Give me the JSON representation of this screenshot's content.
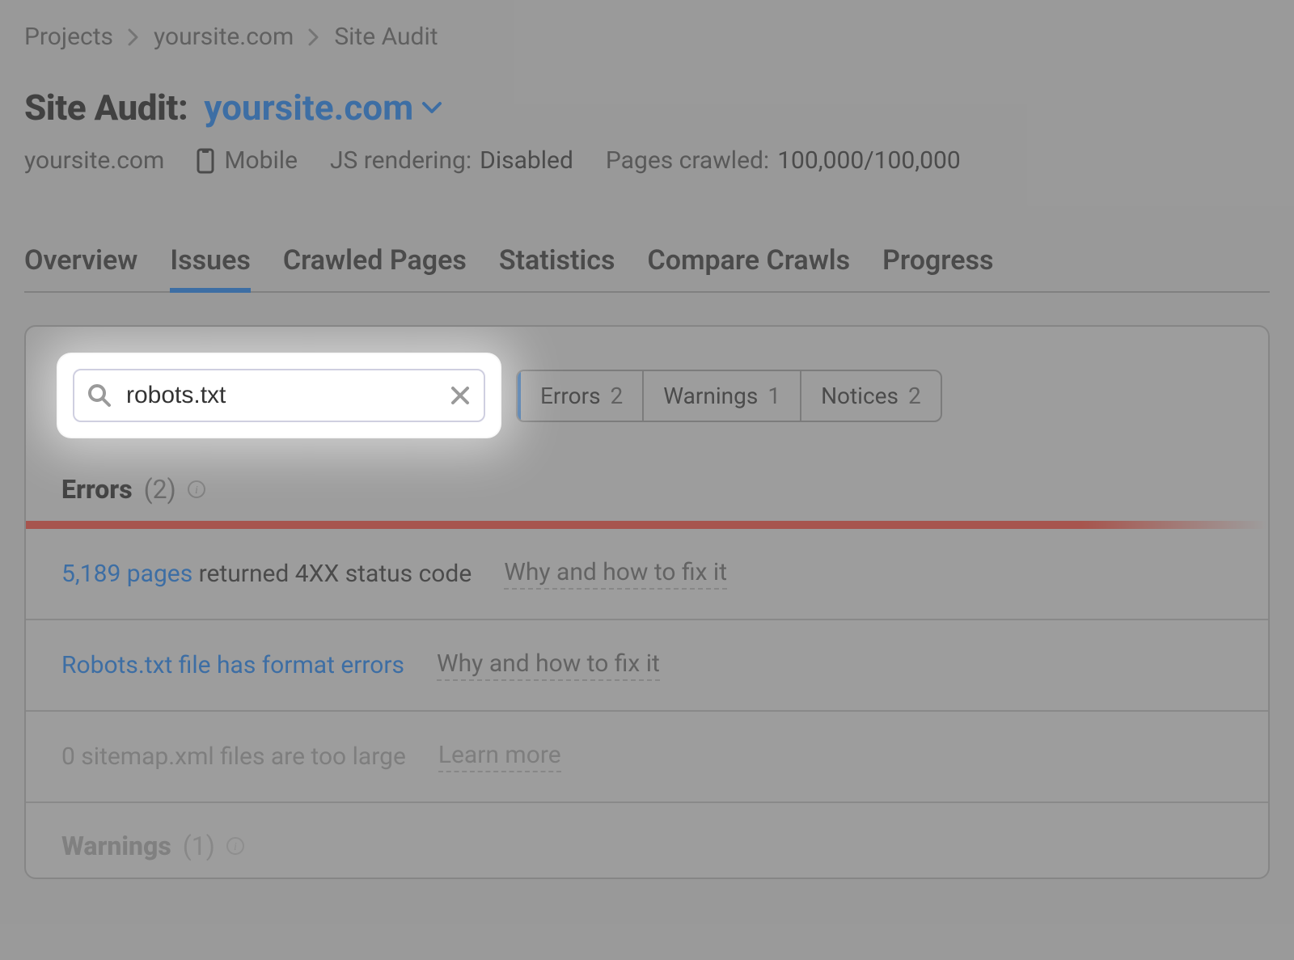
{
  "breadcrumbs": [
    "Projects",
    "yoursite.com",
    "Site Audit"
  ],
  "title": {
    "label": "Site Audit:",
    "domain": "yoursite.com"
  },
  "meta": {
    "domain": "yoursite.com",
    "device": "Mobile",
    "js_label": "JS rendering:",
    "js_value": "Disabled",
    "crawled_label": "Pages crawled:",
    "crawled_value": "100,000/100,000"
  },
  "tabs": {
    "items": [
      "Overview",
      "Issues",
      "Crawled Pages",
      "Statistics",
      "Compare Crawls",
      "Progress"
    ],
    "active_index": 1
  },
  "search": {
    "value": "robots.txt"
  },
  "filters": {
    "errors_label": "Errors",
    "errors_count": "2",
    "warnings_label": "Warnings",
    "warnings_count": "1",
    "notices_label": "Notices",
    "notices_count": "2"
  },
  "sections": {
    "errors": {
      "name": "Errors",
      "count": "(2)",
      "rows": [
        {
          "pages_link": "5,189 pages",
          "tail": " returned 4XX status code",
          "fix": "Why and how to fix it"
        },
        {
          "issue_link": "Robots.txt file has format errors",
          "fix": "Why and how to fix it"
        },
        {
          "dim_text": "0 sitemap.xml files are too large",
          "fix": "Learn more"
        }
      ]
    },
    "warnings": {
      "name": "Warnings",
      "count": "(1)"
    }
  }
}
